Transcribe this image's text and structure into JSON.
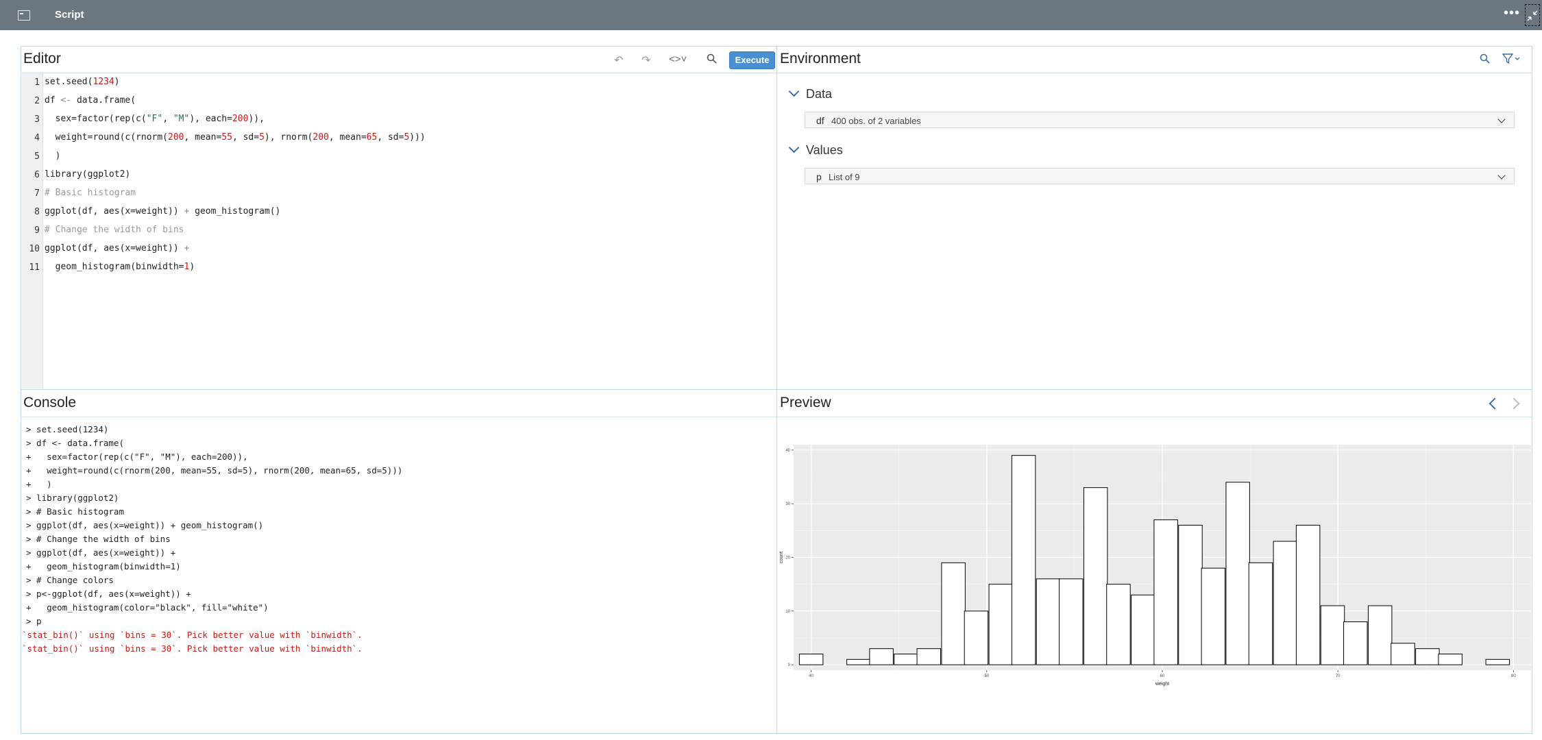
{
  "window": {
    "title": "Script"
  },
  "editor": {
    "title": "Editor",
    "execute_label": "Execute",
    "line_numbers": [
      "1",
      "2",
      "3",
      "4",
      "5",
      "6",
      "7",
      "8",
      "9",
      "10",
      "11"
    ]
  },
  "environment": {
    "title": "Environment",
    "data_section": "Data",
    "data_name": "df",
    "data_desc": "400 obs. of 2 variables",
    "values_section": "Values",
    "values_name": "p",
    "values_desc": "List of 9"
  },
  "console": {
    "title": "Console",
    "lines": [
      "> set.seed(1234)",
      "> df <- data.frame(",
      "+   sex=factor(rep(c(\"F\", \"M\"), each=200)),",
      "+   weight=round(c(rnorm(200, mean=55, sd=5), rnorm(200, mean=65, sd=5)))",
      "+   )",
      "> library(ggplot2)",
      "> # Basic histogram",
      "> ggplot(df, aes(x=weight)) + geom_histogram()",
      "> # Change the width of bins",
      "> ggplot(df, aes(x=weight)) +",
      "+   geom_histogram(binwidth=1)",
      "> # Change colors",
      "> p<-ggplot(df, aes(x=weight)) +",
      "+   geom_histogram(color=\"black\", fill=\"white\")",
      "> p"
    ],
    "errors": [
      "`stat_bin()` using `bins = 30`. Pick better value with `binwidth`.",
      "`stat_bin()` using `bins = 30`. Pick better value with `binwidth`."
    ]
  },
  "preview": {
    "title": "Preview"
  },
  "chart_data": {
    "type": "bar",
    "xlabel": "weight",
    "ylabel": "count",
    "xlim": [
      39,
      81
    ],
    "ylim": [
      -1,
      41
    ],
    "xticks": [
      40,
      50,
      60,
      70,
      80
    ],
    "yticks": [
      0,
      10,
      20,
      30,
      40
    ],
    "bin_width": 1.345,
    "bin_centers": [
      40.0,
      41.3,
      42.7,
      44.0,
      45.4,
      46.7,
      48.1,
      49.4,
      50.8,
      52.1,
      53.5,
      54.8,
      56.2,
      57.5,
      58.9,
      60.2,
      61.6,
      62.9,
      64.3,
      65.6,
      67.0,
      68.3,
      69.7,
      71.0,
      72.4,
      73.7,
      75.1,
      76.4,
      77.8,
      79.1,
      80.5
    ],
    "values": [
      2,
      0,
      1,
      3,
      2,
      3,
      19,
      10,
      15,
      39,
      16,
      16,
      33,
      15,
      13,
      27,
      26,
      18,
      34,
      19,
      23,
      26,
      11,
      8,
      11,
      4,
      3,
      2,
      0,
      1
    ],
    "grid": true,
    "background": "#ebebeb",
    "bar_fill": "#ffffff",
    "bar_stroke": "#000000"
  }
}
